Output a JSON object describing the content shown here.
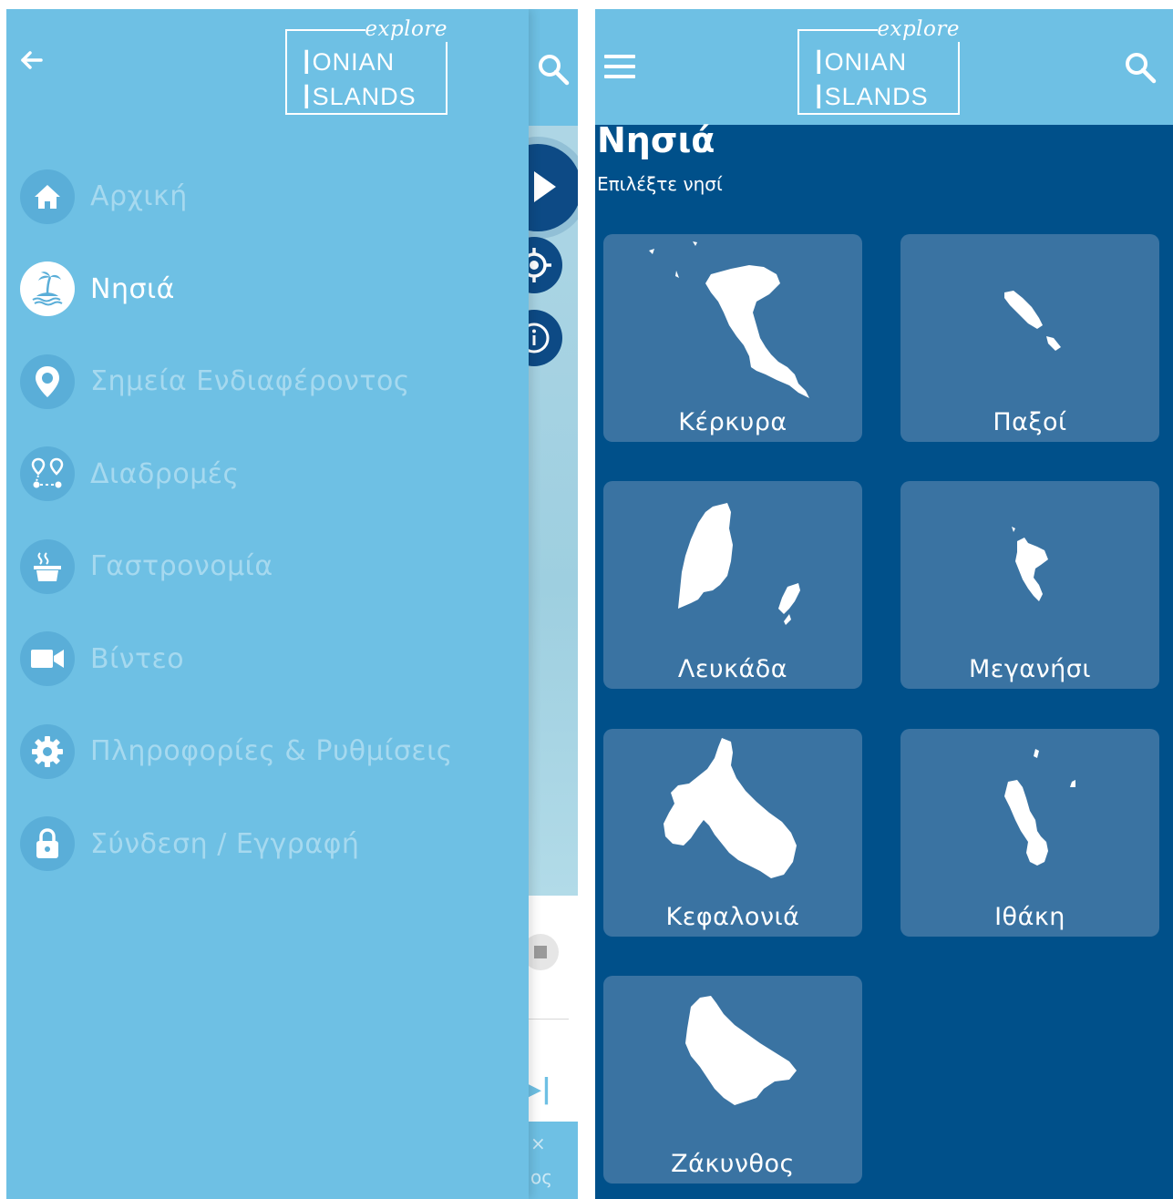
{
  "left_screen": {
    "logo": {
      "explore": "explore",
      "line1_initial": "I",
      "line1_rest": "ONIAN",
      "line2_initial": "I",
      "line2_rest": "SLANDS"
    },
    "back_icon": "arrow-left-icon",
    "underlay": {
      "partial_text": "ος",
      "close_glyph": "×"
    },
    "menu": [
      {
        "label": "Αρχική",
        "icon": "home-icon",
        "active": false
      },
      {
        "label": "Νησιά",
        "icon": "island-icon",
        "active": true
      },
      {
        "label": "Σημεία Ενδιαφέροντος",
        "icon": "map-pin-icon",
        "active": false
      },
      {
        "label": "Διαδρομές",
        "icon": "route-icon",
        "active": false
      },
      {
        "label": "Γαστρονομία",
        "icon": "cooking-pot-icon",
        "active": false
      },
      {
        "label": "Βίντεο",
        "icon": "video-camera-icon",
        "active": false
      },
      {
        "label": "Πληροφορίες & Ρυθμίσεις",
        "icon": "gear-icon",
        "active": false
      },
      {
        "label": "Σύνδεση / Εγγραφή",
        "icon": "lock-icon",
        "active": false
      }
    ]
  },
  "right_screen": {
    "logo": {
      "explore": "explore",
      "line1_initial": "I",
      "line1_rest": "ONIAN",
      "line2_initial": "I",
      "line2_rest": "SLANDS"
    },
    "title": "Νησιά",
    "subtitle": "Επιλέξτε νησί",
    "islands": [
      {
        "name": "Κέρκυρα"
      },
      {
        "name": "Παξοί"
      },
      {
        "name": "Λευκάδα"
      },
      {
        "name": "Μεγανήσι"
      },
      {
        "name": "Κεφαλονιά"
      },
      {
        "name": "Ιθάκη"
      },
      {
        "name": "Ζάκυνθος"
      }
    ]
  },
  "colors": {
    "header": "#6ec0e4",
    "background_dark": "#00508a",
    "card": "#3a73a2",
    "menu_icon_bg": "#5aaed8",
    "menu_text_inactive": "#a6d9ef"
  }
}
